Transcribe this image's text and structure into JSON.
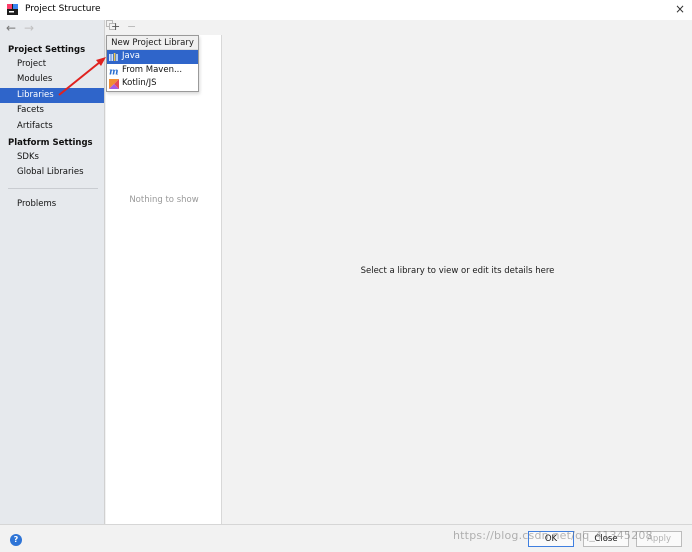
{
  "window": {
    "title": "Project Structure",
    "close_glyph": "×"
  },
  "nav": {
    "back": "←",
    "forward": "→"
  },
  "sidebar": {
    "project_settings_header": "Project Settings",
    "project_items": [
      "Project",
      "Modules",
      "Libraries",
      "Facets",
      "Artifacts"
    ],
    "platform_settings_header": "Platform Settings",
    "platform_items": [
      "SDKs",
      "Global Libraries"
    ],
    "problems": "Problems",
    "selected": "Libraries"
  },
  "toolbar": {
    "add": "+",
    "remove": "−",
    "copy_icon": "copy-icon"
  },
  "library_list": {
    "empty_text": "Nothing to show"
  },
  "detail": {
    "hint": "Select a library to view or edit its details here"
  },
  "popup": {
    "header": "New Project Library",
    "items": [
      {
        "label": "Java",
        "icon": "java-library-icon"
      },
      {
        "label": "From Maven...",
        "icon": "maven-icon"
      },
      {
        "label": "Kotlin/JS",
        "icon": "kotlin-icon"
      }
    ],
    "selected": "Java"
  },
  "buttons": {
    "help": "?",
    "ok": "OK",
    "close": "Close",
    "apply": "Apply"
  },
  "watermark": "https://blog.csdn.net/qq_41345208",
  "colors": {
    "selection": "#2f65ca",
    "annotation_arrow": "#e0221f",
    "help": "#2e74d6"
  }
}
